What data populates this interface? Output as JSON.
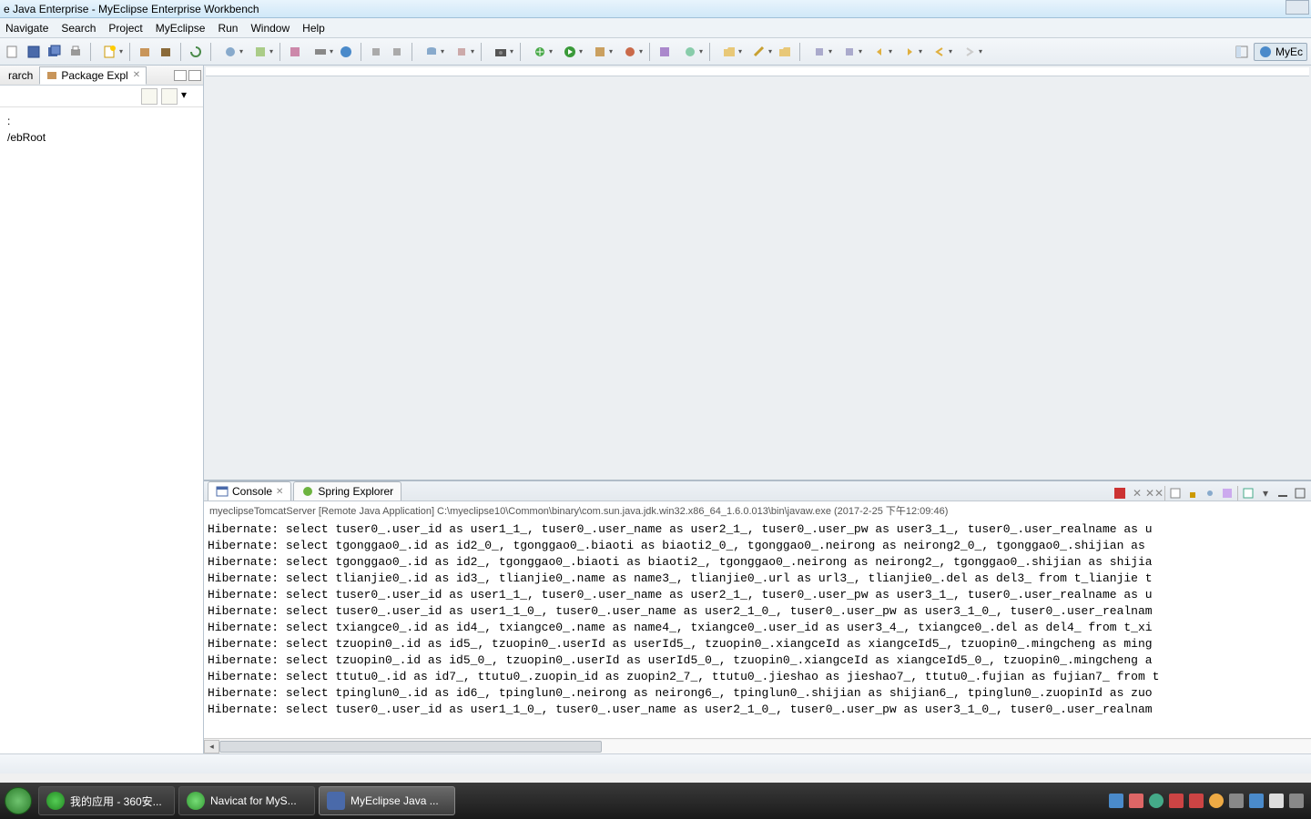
{
  "window": {
    "title": "e Java Enterprise - MyEclipse Enterprise Workbench"
  },
  "menu": [
    "Navigate",
    "Search",
    "Project",
    "MyEclipse",
    "Run",
    "Window",
    "Help"
  ],
  "perspective": {
    "label": "MyEc"
  },
  "sidebar": {
    "tabs": [
      {
        "label": "rarch"
      },
      {
        "label": "Package Expl"
      }
    ],
    "tree": [
      ":",
      "/ebRoot"
    ]
  },
  "bottom": {
    "tabs": [
      {
        "label": "Console"
      },
      {
        "label": "Spring Explorer"
      }
    ],
    "header": "myeclipseTomcatServer [Remote Java Application] C:\\myeclipse10\\Common\\binary\\com.sun.java.jdk.win32.x86_64_1.6.0.013\\bin\\javaw.exe (2017-2-25 下午12:09:46)",
    "lines": [
      "Hibernate: select tuser0_.user_id as user1_1_, tuser0_.user_name as user2_1_, tuser0_.user_pw as user3_1_, tuser0_.user_realname as u",
      "Hibernate: select tgonggao0_.id as id2_0_, tgonggao0_.biaoti as biaoti2_0_, tgonggao0_.neirong as neirong2_0_, tgonggao0_.shijian as ",
      "Hibernate: select tgonggao0_.id as id2_, tgonggao0_.biaoti as biaoti2_, tgonggao0_.neirong as neirong2_, tgonggao0_.shijian as shijia",
      "Hibernate: select tlianjie0_.id as id3_, tlianjie0_.name as name3_, tlianjie0_.url as url3_, tlianjie0_.del as del3_ from t_lianjie t",
      "Hibernate: select tuser0_.user_id as user1_1_, tuser0_.user_name as user2_1_, tuser0_.user_pw as user3_1_, tuser0_.user_realname as u",
      "Hibernate: select tuser0_.user_id as user1_1_0_, tuser0_.user_name as user2_1_0_, tuser0_.user_pw as user3_1_0_, tuser0_.user_realnam",
      "Hibernate: select txiangce0_.id as id4_, txiangce0_.name as name4_, txiangce0_.user_id as user3_4_, txiangce0_.del as del4_ from t_xi",
      "Hibernate: select tzuopin0_.id as id5_, tzuopin0_.userId as userId5_, tzuopin0_.xiangceId as xiangceId5_, tzuopin0_.mingcheng as ming",
      "Hibernate: select tzuopin0_.id as id5_0_, tzuopin0_.userId as userId5_0_, tzuopin0_.xiangceId as xiangceId5_0_, tzuopin0_.mingcheng a",
      "Hibernate: select ttutu0_.id as id7_, ttutu0_.zuopin_id as zuopin2_7_, ttutu0_.jieshao as jieshao7_, ttutu0_.fujian as fujian7_ from t",
      "Hibernate: select tpinglun0_.id as id6_, tpinglun0_.neirong as neirong6_, tpinglun0_.shijian as shijian6_, tpinglun0_.zuopinId as zuo",
      "Hibernate: select tuser0_.user_id as user1_1_0_, tuser0_.user_name as user2_1_0_, tuser0_.user_pw as user3_1_0_, tuser0_.user_realnam"
    ]
  },
  "taskbar": {
    "items": [
      {
        "label": "我的应用 - 360安..."
      },
      {
        "label": "Navicat for MyS..."
      },
      {
        "label": "MyEclipse Java ..."
      }
    ]
  }
}
